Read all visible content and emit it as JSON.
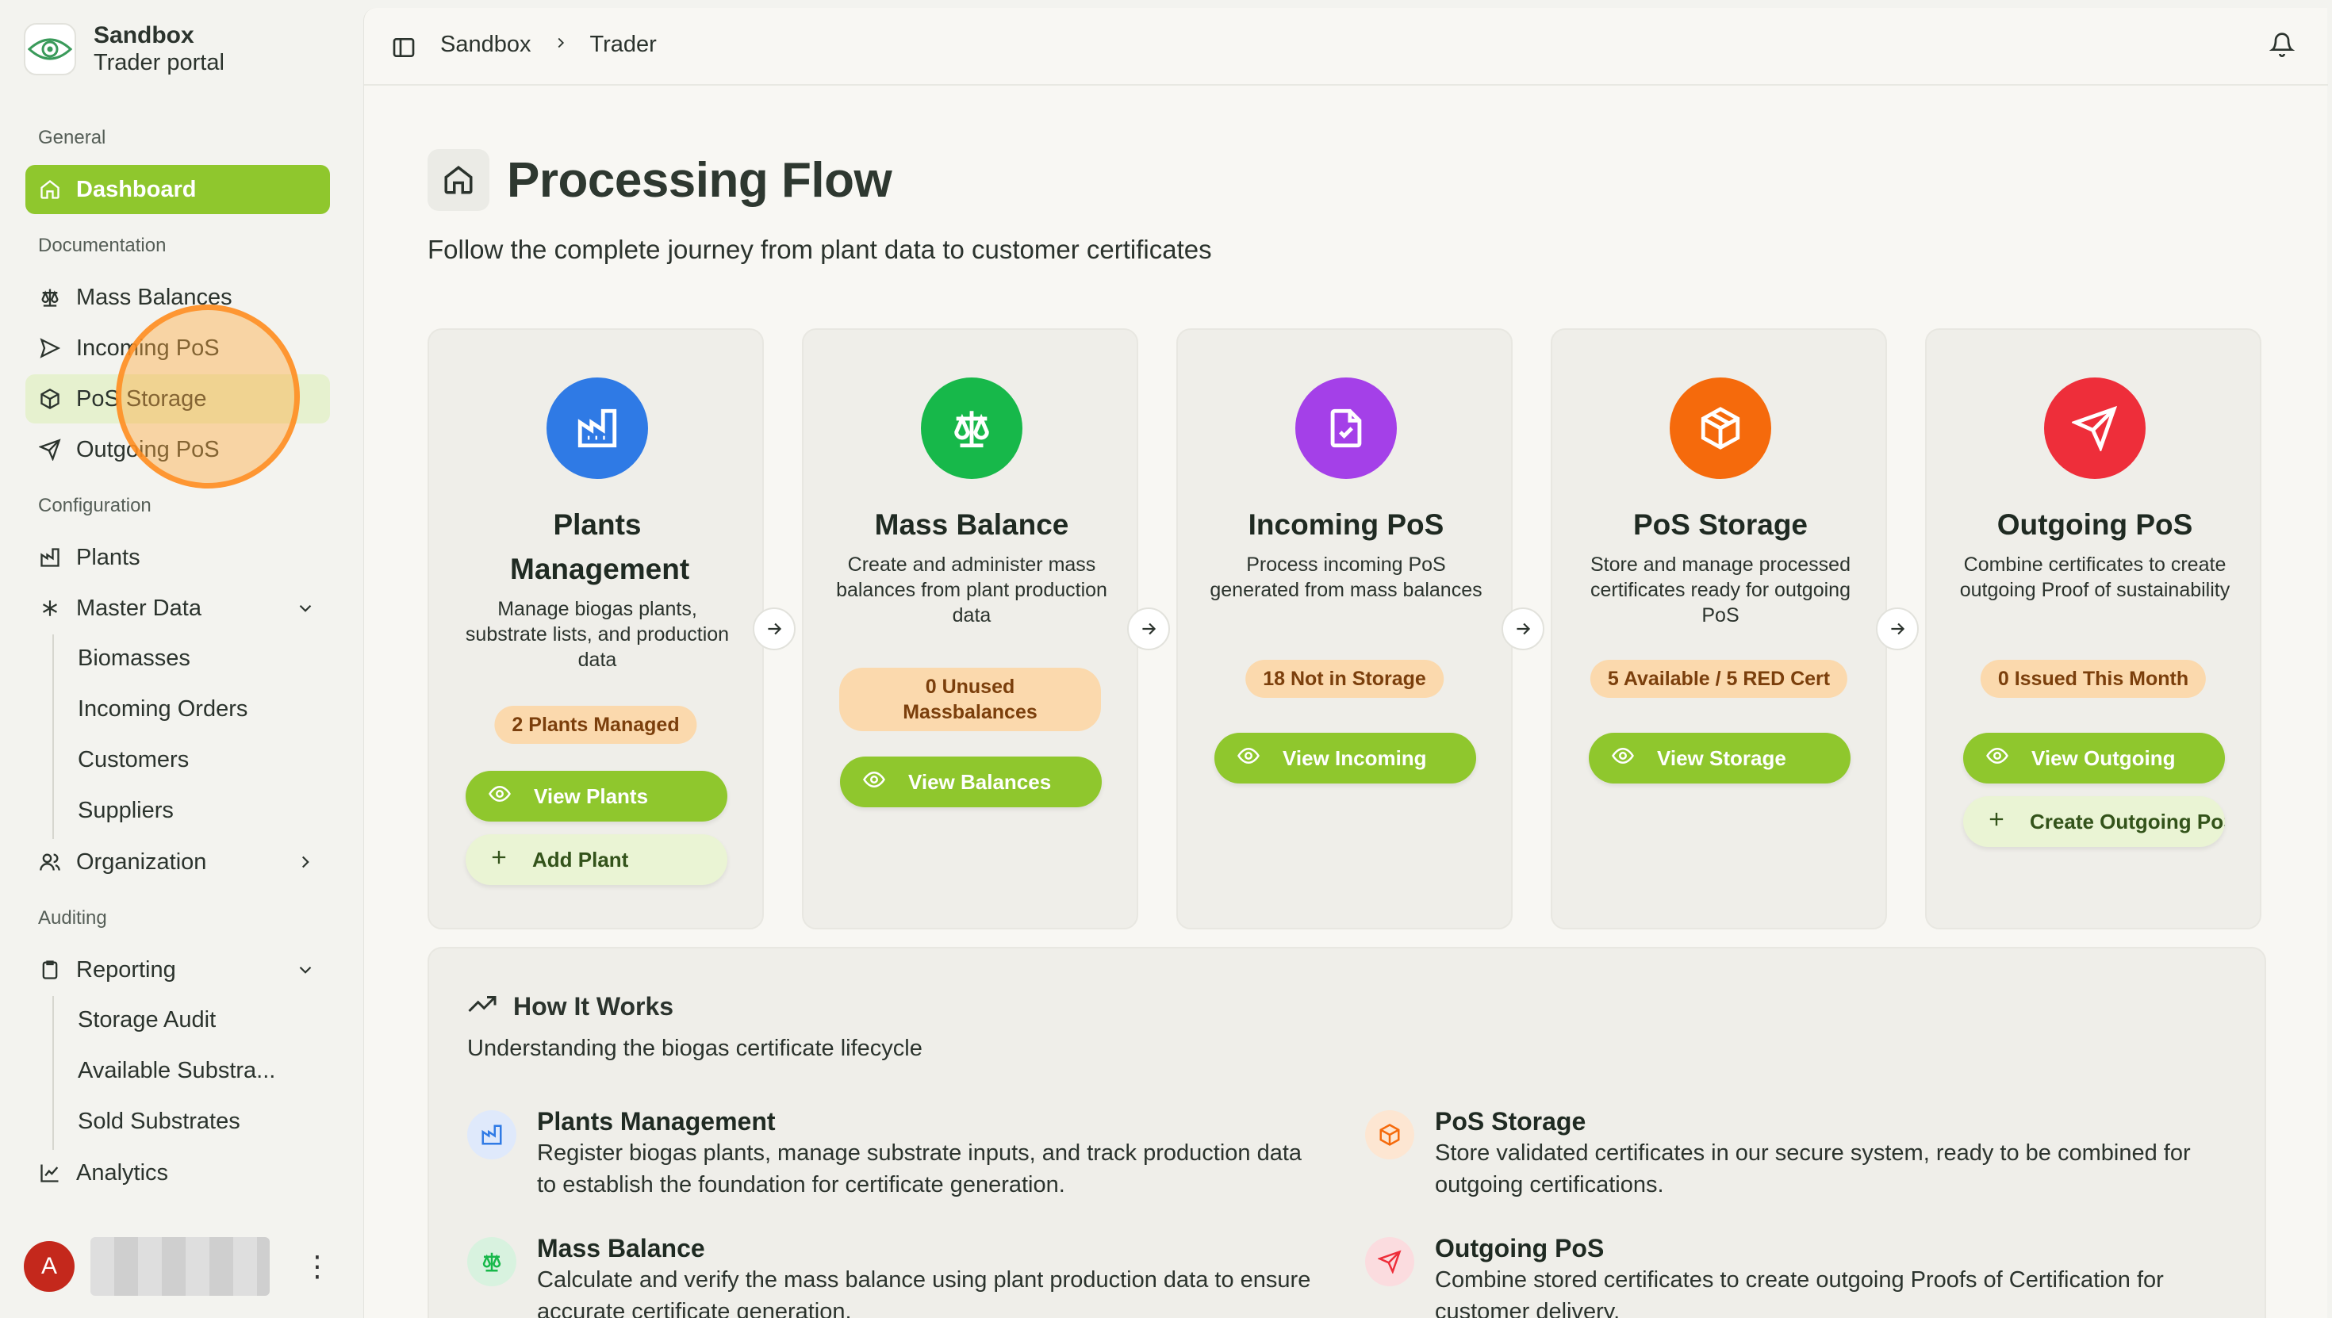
{
  "brand": {
    "name": "Sandbox",
    "subtitle": "Trader portal"
  },
  "sidebar": {
    "groups": {
      "general": "General",
      "documentation": "Documentation",
      "configuration": "Configuration",
      "auditing": "Auditing"
    },
    "dashboard": "Dashboard",
    "mass_balances": "Mass Balances",
    "incoming_pos": "Incoming PoS",
    "pos_storage": "PoS Storage",
    "outgoing_pos": "Outgoing PoS",
    "plants": "Plants",
    "master_data": "Master Data",
    "master_data_items": [
      "Biomasses",
      "Incoming Orders",
      "Customers",
      "Suppliers"
    ],
    "organization": "Organization",
    "reporting": "Reporting",
    "reporting_items": [
      "Storage Audit",
      "Available Substra...",
      "Sold Substrates"
    ],
    "analytics": "Analytics"
  },
  "user": {
    "initial": "A"
  },
  "breadcrumb": [
    "Sandbox",
    "Trader"
  ],
  "page": {
    "title": "Processing Flow",
    "subtitle": "Follow the complete journey from plant data to customer certificates"
  },
  "cards": [
    {
      "title": "Plants Management",
      "desc": "Manage biogas plants, substrate lists, and production data",
      "badge": "2 Plants Managed",
      "primary": "View Plants",
      "secondary": "Add Plant",
      "color": "#2f7ae5"
    },
    {
      "title": "Mass Balance",
      "desc": "Create and administer mass balances from plant production data",
      "badge": "0 Unused Massbalances",
      "primary": "View Balances",
      "color": "#17b84a"
    },
    {
      "title": "Incoming PoS",
      "desc": "Process incoming PoS generated from mass balances",
      "badge": "18 Not in Storage",
      "primary": "View Incoming",
      "color": "#a440e8"
    },
    {
      "title": "PoS Storage",
      "desc": "Store and manage processed certificates ready for outgoing PoS",
      "badge": "5 Available / 5 RED Cert",
      "primary": "View Storage",
      "color": "#f56a0c"
    },
    {
      "title": "Outgoing PoS",
      "desc": "Combine certificates to create outgoing Proof of sustainability",
      "badge": "0 Issued This Month",
      "primary": "View Outgoing",
      "secondary": "Create Outgoing PoS",
      "color": "#ee2e3a"
    }
  ],
  "how": {
    "title": "How It Works",
    "subtitle": "Understanding the biogas certificate lifecycle",
    "steps": [
      {
        "title": "Plants Management",
        "desc": "Register biogas plants, manage substrate inputs, and track production data to establish the foundation for certificate generation."
      },
      {
        "title": "PoS Storage",
        "desc": "Store validated certificates in our secure system, ready to be combined for outgoing certifications."
      },
      {
        "title": "Mass Balance",
        "desc": "Calculate and verify the mass balance using plant production data to ensure accurate certificate generation."
      },
      {
        "title": "Outgoing PoS",
        "desc": "Combine stored certificates to create outgoing Proofs of Certification for customer delivery."
      }
    ]
  },
  "colors": {
    "accent": "#8fc72d",
    "badge_bg": "#fbd9ad",
    "badge_text": "#7b3f0c"
  }
}
